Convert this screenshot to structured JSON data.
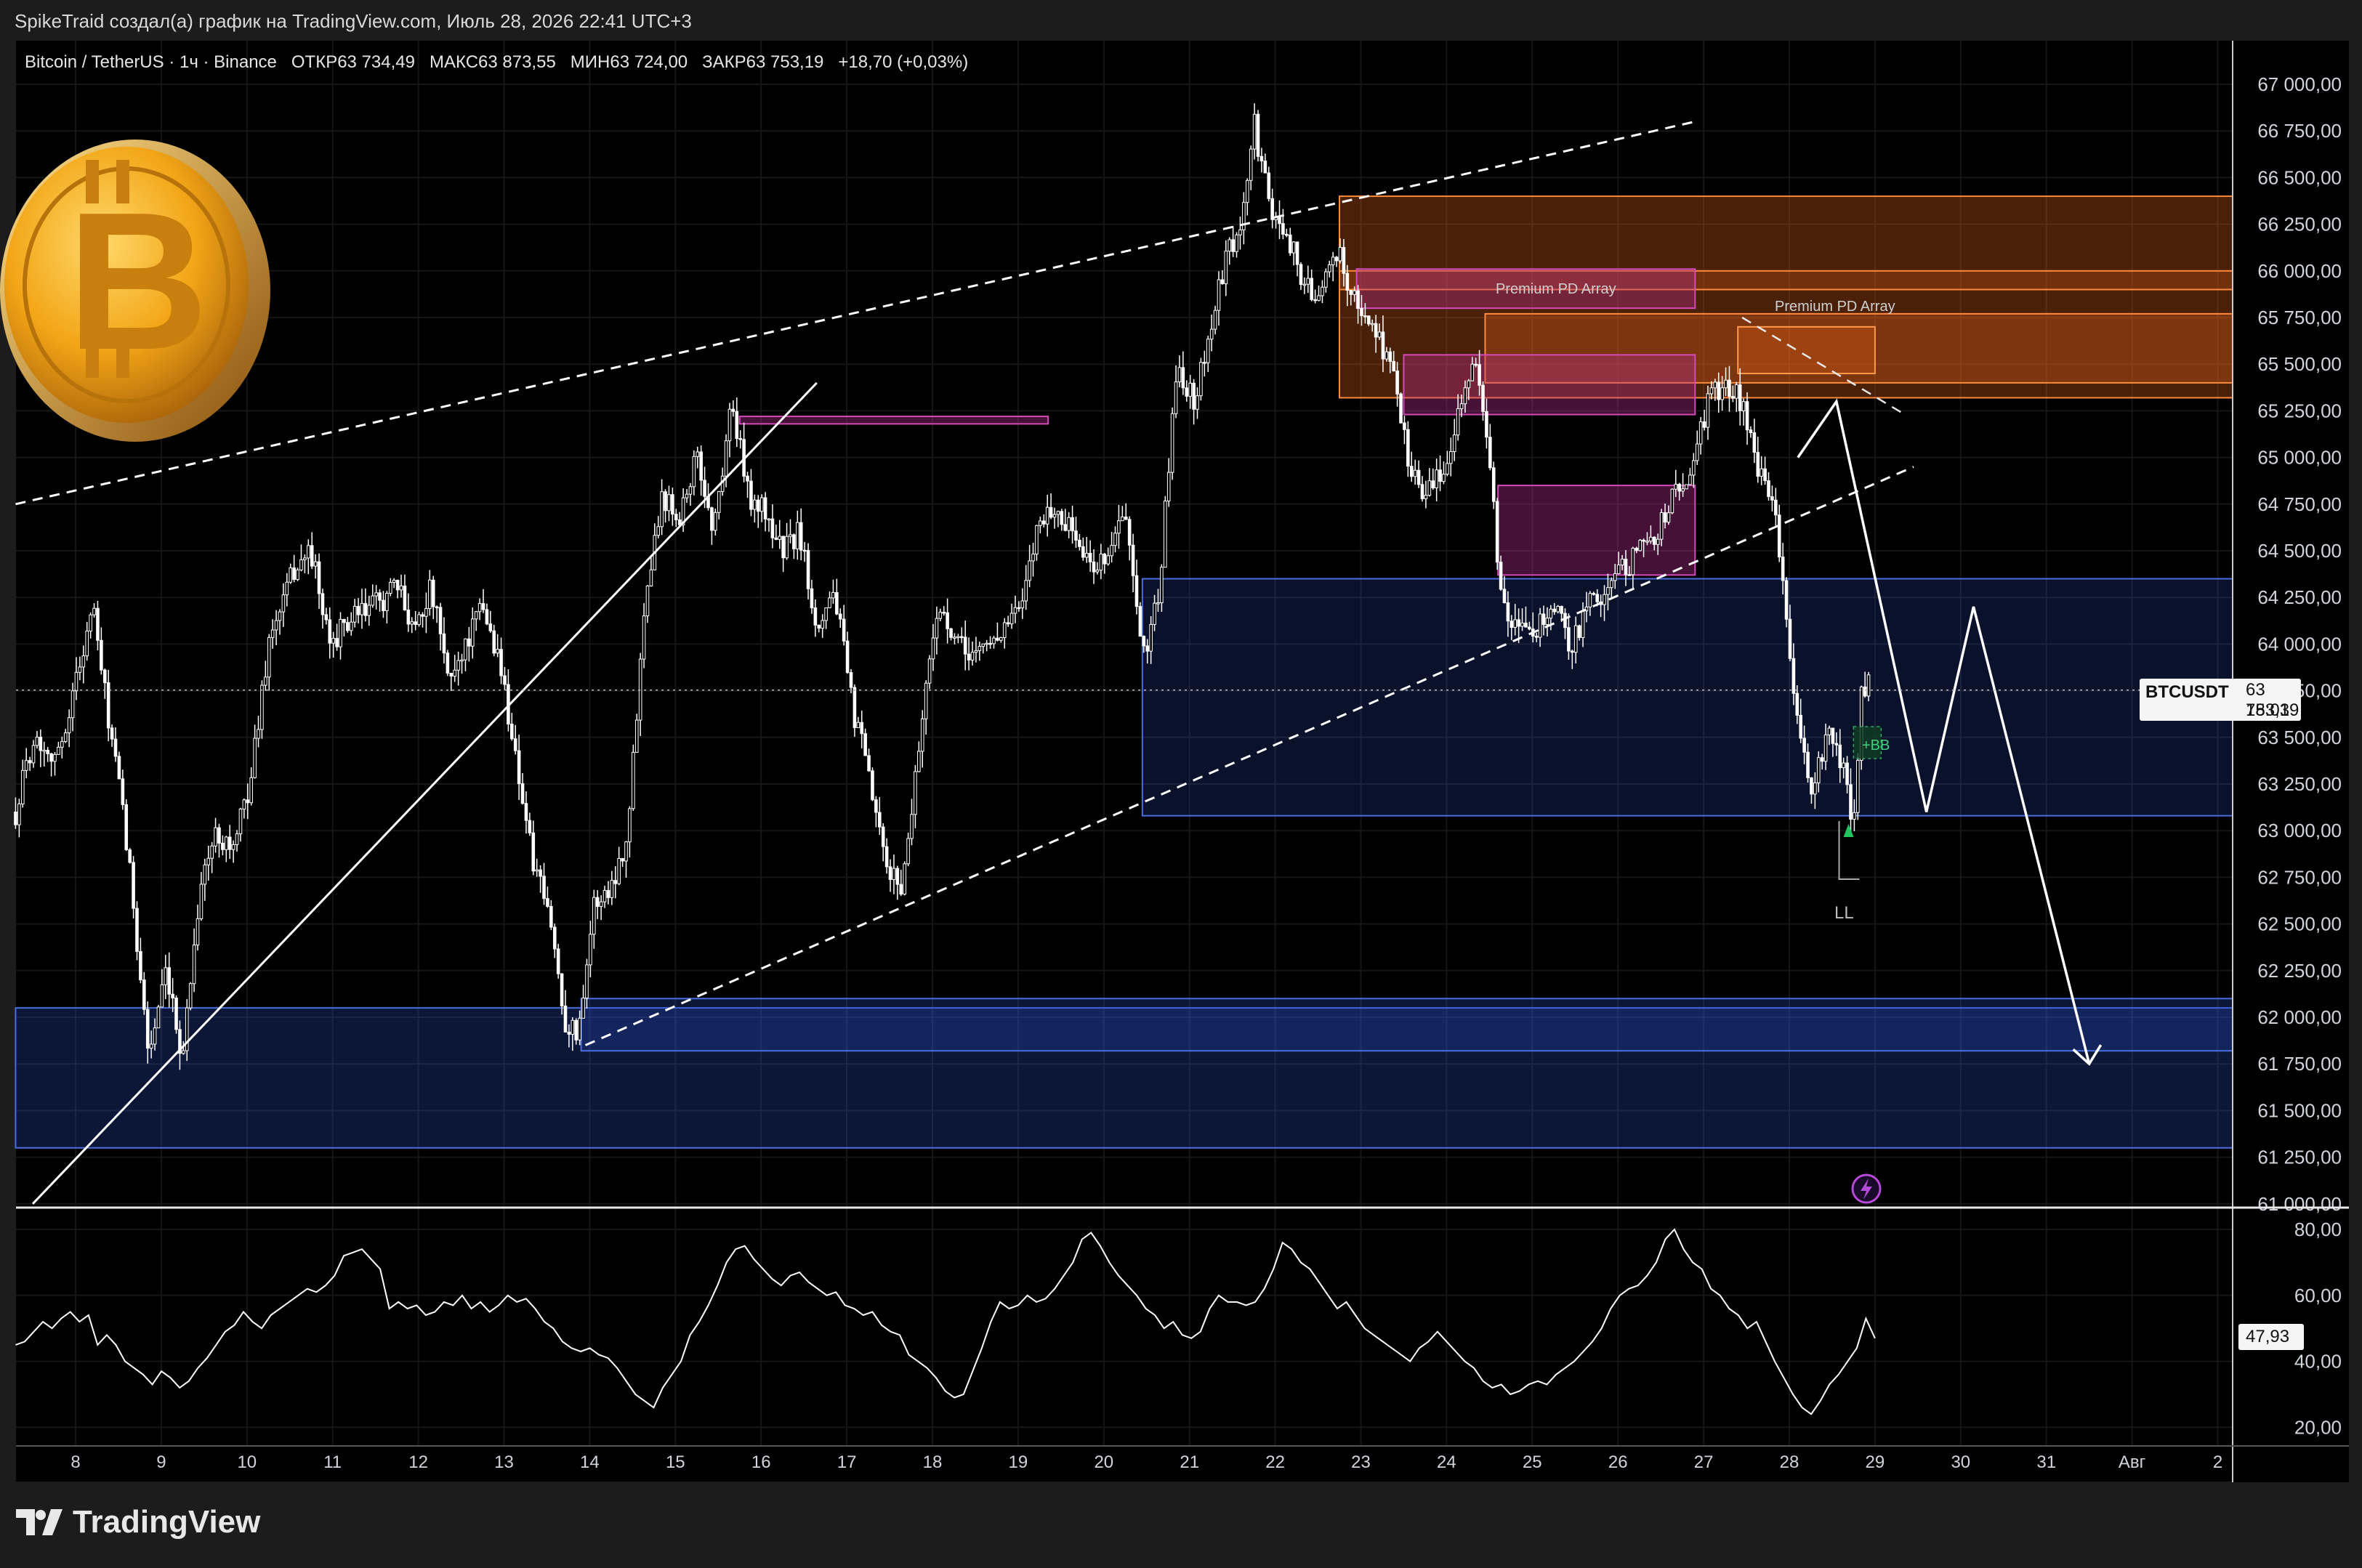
{
  "header": {
    "credit": "SpikeTraid создал(а) график на TradingView.com, Июль 28, 2026 22:41 UTC+3"
  },
  "legend": {
    "symbol": "Bitcoin / TetherUS · 1ч · Binance",
    "open": "ОТКР63 734,49",
    "high": "МАКС63 873,55",
    "low": "МИН63 724,00",
    "close": "ЗАКР63 753,19",
    "change": "+18,70 (+0,03%)"
  },
  "price_tag": {
    "symbol": "BTCUSDT",
    "price": "63 753,19",
    "countdown": "18:03"
  },
  "rsi_tag": "47,93",
  "labels": {
    "premium1": "Premium PD Array",
    "premium2": "Premium PD Array",
    "ll": "LL",
    "bb": "+BB"
  },
  "branding": {
    "logo_text": "TradingView"
  },
  "colors": {
    "background": "#000000",
    "panel": "#1c1c1c",
    "candle": "#ffffff",
    "supply_zone": "#e8641c",
    "premium_pd": "#b52c8e",
    "demand_zone": "#2c4fc4",
    "bitcoin_coin": "#f2a516"
  },
  "icons": [
    "bitcoin-coin-icon",
    "tradingview-logo-icon",
    "lightning-icon"
  ],
  "chart_data": [
    {
      "type": "candlestick",
      "symbol": "BTCUSDT",
      "interval": "1h",
      "ylim": [
        61000,
        67250
      ],
      "y_ticks": [
        "67 000,00",
        "66 750,00",
        "66 500,00",
        "66 250,00",
        "66 000,00",
        "65 750,00",
        "65 500,00",
        "65 250,00",
        "65 000,00",
        "64 750,00",
        "64 500,00",
        "64 250,00",
        "64 000,00",
        "63 750,00",
        "63 500,00",
        "63 250,00",
        "63 000,00",
        "62 750,00",
        "62 500,00",
        "62 250,00",
        "62 000,00",
        "61 750,00",
        "61 500,00",
        "61 250,00",
        "61 000,00"
      ],
      "x_ticks": [
        "8",
        "9",
        "10",
        "11",
        "12",
        "13",
        "14",
        "15",
        "16",
        "17",
        "18",
        "19",
        "20",
        "21",
        "22",
        "23",
        "24",
        "25",
        "26",
        "27",
        "28",
        "29",
        "30",
        "31",
        "Авг",
        "2"
      ],
      "x_tick_days": [
        8,
        9,
        10,
        11,
        12,
        13,
        14,
        15,
        16,
        17,
        18,
        19,
        20,
        21,
        22,
        23,
        24,
        25,
        26,
        27,
        28,
        29,
        30,
        31,
        32,
        33
      ],
      "last_price": 63753.19,
      "price_anchors": [
        [
          7.3,
          63100
        ],
        [
          7.5,
          63500
        ],
        [
          7.8,
          63400
        ],
        [
          8.0,
          63800
        ],
        [
          8.2,
          64200
        ],
        [
          8.35,
          63700
        ],
        [
          8.55,
          63100
        ],
        [
          8.7,
          62500
        ],
        [
          8.85,
          61800
        ],
        [
          9.05,
          62200
        ],
        [
          9.25,
          61800
        ],
        [
          9.45,
          62700
        ],
        [
          9.65,
          63000
        ],
        [
          9.85,
          62900
        ],
        [
          10.05,
          63300
        ],
        [
          10.25,
          64000
        ],
        [
          10.55,
          64400
        ],
        [
          10.75,
          64500
        ],
        [
          10.95,
          64000
        ],
        [
          11.15,
          64100
        ],
        [
          11.45,
          64200
        ],
        [
          11.75,
          64300
        ],
        [
          11.95,
          64100
        ],
        [
          12.15,
          64300
        ],
        [
          12.35,
          63800
        ],
        [
          12.55,
          64000
        ],
        [
          12.75,
          64200
        ],
        [
          12.95,
          63900
        ],
        [
          13.1,
          63500
        ],
        [
          13.35,
          62800
        ],
        [
          13.55,
          62500
        ],
        [
          13.7,
          62000
        ],
        [
          13.85,
          61900
        ],
        [
          14.05,
          62600
        ],
        [
          14.25,
          62700
        ],
        [
          14.45,
          63000
        ],
        [
          14.65,
          64300
        ],
        [
          14.85,
          64800
        ],
        [
          15.05,
          64700
        ],
        [
          15.25,
          65000
        ],
        [
          15.45,
          64600
        ],
        [
          15.65,
          65300
        ],
        [
          15.85,
          64800
        ],
        [
          16.05,
          64700
        ],
        [
          16.25,
          64500
        ],
        [
          16.45,
          64600
        ],
        [
          16.65,
          64100
        ],
        [
          16.85,
          64300
        ],
        [
          17.05,
          63700
        ],
        [
          17.25,
          63300
        ],
        [
          17.45,
          62800
        ],
        [
          17.65,
          62700
        ],
        [
          17.85,
          63500
        ],
        [
          18.05,
          64200
        ],
        [
          18.25,
          64000
        ],
        [
          18.45,
          63950
        ],
        [
          18.65,
          64000
        ],
        [
          18.85,
          64100
        ],
        [
          19.05,
          64200
        ],
        [
          19.25,
          64700
        ],
        [
          19.45,
          64700
        ],
        [
          19.65,
          64600
        ],
        [
          19.85,
          64400
        ],
        [
          20.05,
          64500
        ],
        [
          20.25,
          64700
        ],
        [
          20.45,
          63900
        ],
        [
          20.65,
          64300
        ],
        [
          20.85,
          65500
        ],
        [
          21.05,
          65300
        ],
        [
          21.25,
          65700
        ],
        [
          21.45,
          66100
        ],
        [
          21.6,
          66200
        ],
        [
          21.75,
          66800
        ],
        [
          21.95,
          66300
        ],
        [
          22.15,
          66200
        ],
        [
          22.35,
          65900
        ],
        [
          22.55,
          65900
        ],
        [
          22.75,
          66100
        ],
        [
          22.95,
          65800
        ],
        [
          23.15,
          65700
        ],
        [
          23.35,
          65500
        ],
        [
          23.55,
          65000
        ],
        [
          23.75,
          64800
        ],
        [
          23.95,
          64900
        ],
        [
          24.15,
          65300
        ],
        [
          24.35,
          65500
        ],
        [
          24.45,
          65200
        ],
        [
          24.65,
          64200
        ],
        [
          24.85,
          64050
        ],
        [
          25.05,
          64100
        ],
        [
          25.25,
          64200
        ],
        [
          25.45,
          64000
        ],
        [
          25.65,
          64200
        ],
        [
          25.85,
          64300
        ],
        [
          26.05,
          64400
        ],
        [
          26.25,
          64500
        ],
        [
          26.45,
          64600
        ],
        [
          26.65,
          64800
        ],
        [
          26.85,
          64900
        ],
        [
          27.05,
          65300
        ],
        [
          27.25,
          65400
        ],
        [
          27.45,
          65300
        ],
        [
          27.65,
          64900
        ],
        [
          27.85,
          64700
        ],
        [
          28.05,
          63700
        ],
        [
          28.25,
          63200
        ],
        [
          28.45,
          63500
        ],
        [
          28.65,
          63300
        ],
        [
          28.75,
          63000
        ],
        [
          28.85,
          63800
        ],
        [
          28.95,
          63753
        ]
      ],
      "annotations": {
        "upper_trendline_dashed": [
          [
            7.3,
            64750
          ],
          [
            26.9,
            66800
          ]
        ],
        "lower_trendline_dashed": [
          [
            13.95,
            61850
          ],
          [
            29.45,
            64950
          ]
        ],
        "rising_support_solid": [
          [
            7.5,
            61000
          ],
          [
            16.65,
            65400
          ]
        ],
        "supply_zone_orange": {
          "x": [
            22.75,
            33.3
          ],
          "y": [
            65320,
            66400
          ]
        },
        "supply_band_1": {
          "x": [
            22.75,
            33.3
          ],
          "y": [
            65900,
            66000
          ]
        },
        "supply_band_2": {
          "x": [
            24.45,
            33.3
          ],
          "y": [
            65400,
            65770
          ]
        },
        "supply_band_inner": {
          "x": [
            27.4,
            29.0
          ],
          "y": [
            65450,
            65700
          ]
        },
        "premium_pd_arrays": [
          {
            "x": [
              15.75,
              19.35
            ],
            "y": [
              65180,
              65220
            ]
          },
          {
            "x": [
              22.95,
              26.9
            ],
            "y": [
              65800,
              66010
            ]
          },
          {
            "x": [
              23.5,
              26.9
            ],
            "y": [
              65230,
              65550
            ]
          },
          {
            "x": [
              24.6,
              26.9
            ],
            "y": [
              64370,
              64850
            ]
          }
        ],
        "demand_zone_blue": {
          "x": [
            20.45,
            33.3
          ],
          "y": [
            63080,
            64350
          ]
        },
        "lower_demand_zones": [
          {
            "x": [
              7.3,
              33.3
            ],
            "y": [
              61300,
              62050
            ]
          },
          {
            "x": [
              13.9,
              33.3
            ],
            "y": [
              61820,
              62100
            ]
          }
        ],
        "projection_path": [
          [
            28.1,
            65000
          ],
          [
            28.55,
            65300
          ],
          [
            29.6,
            63100
          ],
          [
            30.15,
            64200
          ],
          [
            31.5,
            61750
          ]
        ],
        "dashed_projection": [
          [
            27.45,
            65750
          ],
          [
            29.35,
            65230
          ]
        ],
        "ll_marker": {
          "x": 28.7,
          "y": 62740
        },
        "bb_marker": {
          "x": 28.8,
          "y": 63550
        }
      }
    },
    {
      "type": "line",
      "name": "RSI",
      "ylim": [
        17,
        82
      ],
      "y_ticks": [
        "80,00",
        "60,00",
        "40,00",
        "20,00"
      ],
      "last_value": 47.93,
      "x_range": [
        7.3,
        29.0
      ],
      "values": [
        45,
        46,
        49,
        52,
        50,
        53,
        55,
        52,
        54,
        45,
        48,
        45,
        40,
        38,
        36,
        33,
        37,
        35,
        32,
        34,
        38,
        41,
        45,
        49,
        51,
        55,
        52,
        50,
        54,
        56,
        58,
        60,
        62,
        61,
        63,
        66,
        72,
        73,
        74,
        71,
        68,
        56,
        58,
        56,
        57,
        54,
        55,
        58,
        57,
        60,
        56,
        58,
        55,
        57,
        60,
        58,
        59,
        56,
        52,
        50,
        46,
        44,
        43,
        44,
        42,
        41,
        38,
        34,
        30,
        28,
        26,
        32,
        36,
        40,
        48,
        52,
        57,
        63,
        70,
        74,
        75,
        71,
        68,
        65,
        63,
        66,
        67,
        64,
        62,
        60,
        61,
        57,
        56,
        54,
        55,
        51,
        49,
        48,
        42,
        40,
        38,
        35,
        31,
        29,
        30,
        37,
        44,
        52,
        58,
        56,
        57,
        60,
        58,
        59,
        62,
        66,
        70,
        77,
        79,
        75,
        70,
        66,
        63,
        60,
        56,
        54,
        50,
        52,
        48,
        47,
        49,
        56,
        60,
        58,
        58,
        57,
        58,
        62,
        68,
        76,
        74,
        70,
        68,
        64,
        60,
        56,
        58,
        54,
        50,
        48,
        46,
        44,
        42,
        40,
        44,
        46,
        49,
        46,
        43,
        40,
        38,
        34,
        32,
        33,
        30,
        31,
        33,
        34,
        33,
        36,
        38,
        40,
        43,
        46,
        50,
        56,
        60,
        62,
        63,
        66,
        70,
        77,
        80,
        74,
        70,
        68,
        62,
        60,
        56,
        54,
        50,
        52,
        46,
        40,
        35,
        30,
        26,
        24,
        28,
        33,
        36,
        40,
        44,
        53,
        47
      ]
    }
  ]
}
